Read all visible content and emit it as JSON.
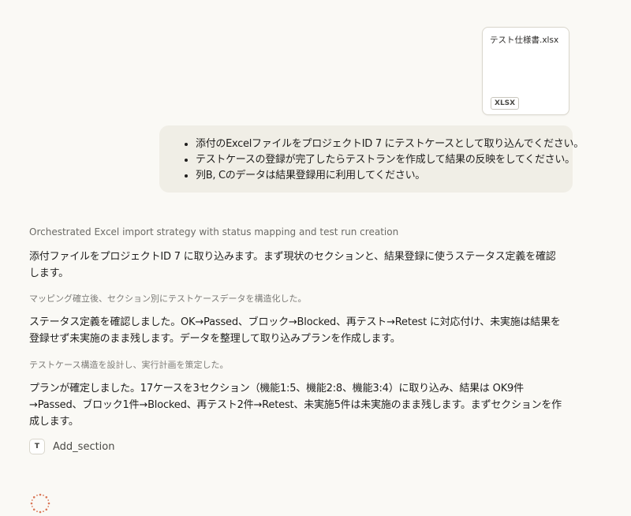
{
  "attachment": {
    "file_name": "テスト仕様書.xlsx",
    "file_type": "XLSX"
  },
  "user_message": {
    "bullets": [
      "添付のExcelファイルをプロジェクトID 7 にテストケースとして取り込んでください。",
      "テストケースの登録が完了したらテストランを作成して結果の反映をしてください。",
      "列B, Cのデータは結果登録用に利用してください。"
    ]
  },
  "assistant": {
    "thinking_summary": "Orchestrated Excel import strategy with status mapping and test run creation",
    "para1": "添付ファイルをプロジェクトID 7 に取り込みます。まず現状のセクションと、結果登録に使うステータス定義を確認します。",
    "note1": "マッピング確立後、セクション別にテストケースデータを構造化した。",
    "para2": "ステータス定義を確認しました。OK→Passed、ブロック→Blocked、再テスト→Retest に対応付け、未実施は結果を登録せず未実施のまま残します。データを整理して取り込みプランを作成します。",
    "note2": "テストケース構造を設計し、実行計画を策定した。",
    "para3": "プランが確定しました。17ケースを3セクション（機能1:5、機能2:8、機能3:4）に取り込み、結果は OK9件→Passed、ブロック1件→Blocked、再テスト2件→Retest、未実施5件は未実施のまま残します。まずセクションを作成します。",
    "tool_call": {
      "icon_letter": "T",
      "icon": "text-tool-icon",
      "label": "Add_section"
    }
  },
  "colors": {
    "background": "#faf9f5",
    "user_bubble": "#f0eee6",
    "spinner": "#d97757"
  }
}
